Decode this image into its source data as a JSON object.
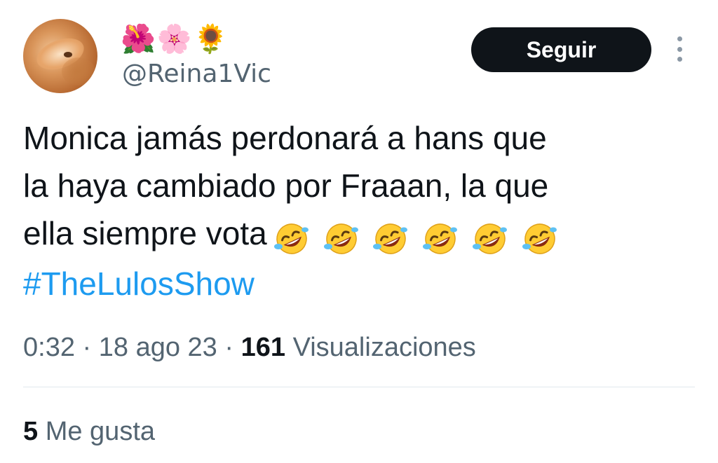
{
  "author": {
    "display_name_emojis": [
      "🌺",
      "🌸",
      "🌻"
    ],
    "handle": "@Reina1Vic"
  },
  "actions": {
    "follow_label": "Seguir",
    "more_icon": "more-vertical-icon"
  },
  "tweet": {
    "lines": [
      "Monica jamás perdonará a hans que",
      "la haya cambiado por Fraaan, la que",
      "ella siempre vota"
    ],
    "emojis": [
      "🤣",
      "🤣",
      "🤣",
      "🤣",
      "🤣",
      "🤣"
    ],
    "hashtag": "#TheLulosShow"
  },
  "meta": {
    "time": "0:32",
    "separator": " · ",
    "date": "18 ago 23",
    "views_count": "161",
    "views_label": "Visualizaciones"
  },
  "engagement": {
    "likes_count": "5",
    "likes_label": "Me gusta"
  },
  "colors": {
    "text": "#0f1419",
    "secondary": "#536471",
    "link": "#1d9bf0",
    "button_bg": "#0f1419"
  }
}
